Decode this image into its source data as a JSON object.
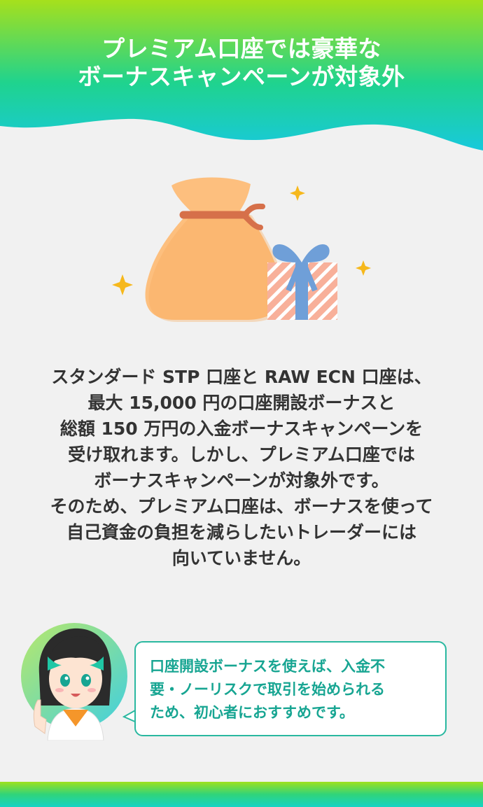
{
  "header": {
    "title_lines": [
      "プレミアム口座では豪華な",
      "ボーナスキャンペーンが対象外"
    ]
  },
  "illustration": {
    "icons": [
      "money-bag-icon",
      "gift-box-icon",
      "sparkle-icon"
    ]
  },
  "body": {
    "lines": [
      "スタンダード STP 口座と RAW ECN 口座は、",
      "最大 15,000 円の口座開設ボーナスと",
      "総額 150 万円の入金ボーナスキャンペーンを",
      "受け取れます。しかし、プレミアム口座では",
      "ボーナスキャンペーンが対象外です。",
      "そのため、プレミアム口座は、ボーナスを使って",
      "自己資金の負担を減らしたいトレーダーには",
      "向いていません。"
    ]
  },
  "speech": {
    "lines": [
      "口座開設ボーナスを使えば、入金不",
      "要・ノーリスクで取引を始められる",
      "ため、初心者におすすめです。"
    ]
  },
  "colors": {
    "header_gradient": [
      "#a6e01c",
      "#1fd38e",
      "#18c9dc"
    ],
    "bubble_border": "#2ab8a0",
    "bubble_text": "#17a592",
    "body_text": "#333333"
  }
}
